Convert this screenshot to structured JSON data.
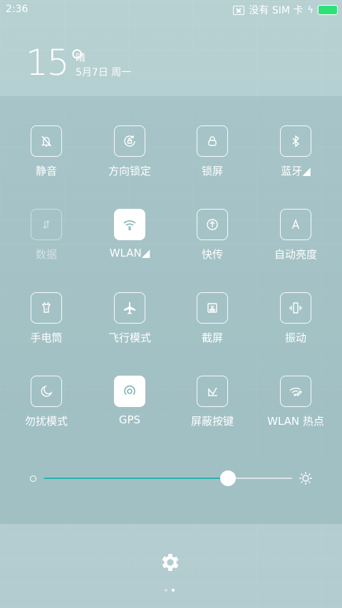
{
  "status_bar": {
    "time": "2:36",
    "no_sim_text": "没有 SIM 卡"
  },
  "weather": {
    "temperature": "15°",
    "condition": "晴",
    "date": "5月7日 周一"
  },
  "tiles": [
    {
      "label": "静音",
      "icon": "silent-bell-icon",
      "state": "off"
    },
    {
      "label": "方向锁定",
      "icon": "rotation-lock-icon",
      "state": "off"
    },
    {
      "label": "锁屏",
      "icon": "lock-icon",
      "state": "off"
    },
    {
      "label": "蓝牙◢",
      "icon": "bluetooth-icon",
      "state": "off"
    },
    {
      "label": "数据",
      "icon": "data-arrows-icon",
      "state": "disabled"
    },
    {
      "label": "WLAN◢",
      "icon": "wifi-icon",
      "state": "on"
    },
    {
      "label": "快传",
      "icon": "quick-share-icon",
      "state": "off"
    },
    {
      "label": "自动亮度",
      "icon": "auto-brightness-icon",
      "state": "off"
    },
    {
      "label": "手电筒",
      "icon": "flashlight-icon",
      "state": "off"
    },
    {
      "label": "飞行模式",
      "icon": "airplane-icon",
      "state": "off"
    },
    {
      "label": "截屏",
      "icon": "screenshot-icon",
      "state": "off"
    },
    {
      "label": "振动",
      "icon": "vibrate-icon",
      "state": "off"
    },
    {
      "label": "勿扰模式",
      "icon": "moon-icon",
      "state": "off"
    },
    {
      "label": "GPS",
      "icon": "gps-icon",
      "state": "on"
    },
    {
      "label": "屏蔽按键",
      "icon": "block-keys-icon",
      "state": "off"
    },
    {
      "label": "WLAN 热点",
      "icon": "hotspot-icon",
      "state": "off"
    }
  ],
  "brightness": {
    "level": 0.74,
    "accent": "#29b3ad"
  },
  "settings_icon": "gear-icon",
  "pager": {
    "pages": 2,
    "current": 2
  }
}
